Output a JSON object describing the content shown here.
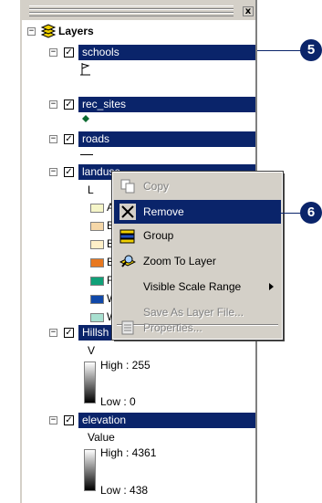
{
  "panel": {
    "close_glyph": "x"
  },
  "toc": {
    "root_label": "Layers",
    "layers": [
      {
        "name": "schools",
        "checked": true
      },
      {
        "name": "rec_sites",
        "checked": true
      },
      {
        "name": "roads",
        "checked": true
      },
      {
        "name": "landuse",
        "checked": true,
        "legend_heading": "L",
        "legend": [
          {
            "label": "A",
            "color": "#f5f5c8"
          },
          {
            "label": "B",
            "color": "#f5d7a8"
          },
          {
            "label": "B",
            "color": "#fff0c8"
          },
          {
            "label": "B",
            "color": "#e87820"
          },
          {
            "label": "Fo",
            "color": "#10a078"
          },
          {
            "label": "W",
            "color": "#1048a8"
          },
          {
            "label": "W",
            "color": "#a8e0d0"
          }
        ]
      },
      {
        "name": "Hillsh",
        "checked": true,
        "value_label": "V",
        "high": "High : 255",
        "low": "Low : 0"
      },
      {
        "name": "elevation",
        "checked": true,
        "value_label": "Value",
        "high": "High : 4361",
        "low": "Low : 438"
      }
    ]
  },
  "context_menu": {
    "items": [
      {
        "label": "Copy",
        "icon": "copy-icon",
        "enabled": false,
        "highlighted": false
      },
      {
        "label": "Remove",
        "icon": "remove-x-icon",
        "enabled": true,
        "highlighted": true
      },
      {
        "label": "Group",
        "icon": "group-icon",
        "enabled": true,
        "highlighted": false
      },
      {
        "label": "Zoom To Layer",
        "icon": "zoom-to-layer-icon",
        "enabled": true,
        "highlighted": false
      },
      {
        "label": "Visible Scale Range",
        "icon": "",
        "enabled": true,
        "highlighted": false,
        "submenu": true
      },
      {
        "label": "Save As Layer File...",
        "icon": "",
        "enabled": false,
        "highlighted": false
      },
      {
        "label": "Properties...",
        "icon": "properties-icon",
        "enabled": false,
        "highlighted": false
      }
    ]
  },
  "callouts": [
    {
      "label": "5"
    },
    {
      "label": "6"
    }
  ],
  "colors": {
    "selection": "#0a246a",
    "callout": "#0a246a",
    "menu_bg": "#d4d0c8"
  }
}
